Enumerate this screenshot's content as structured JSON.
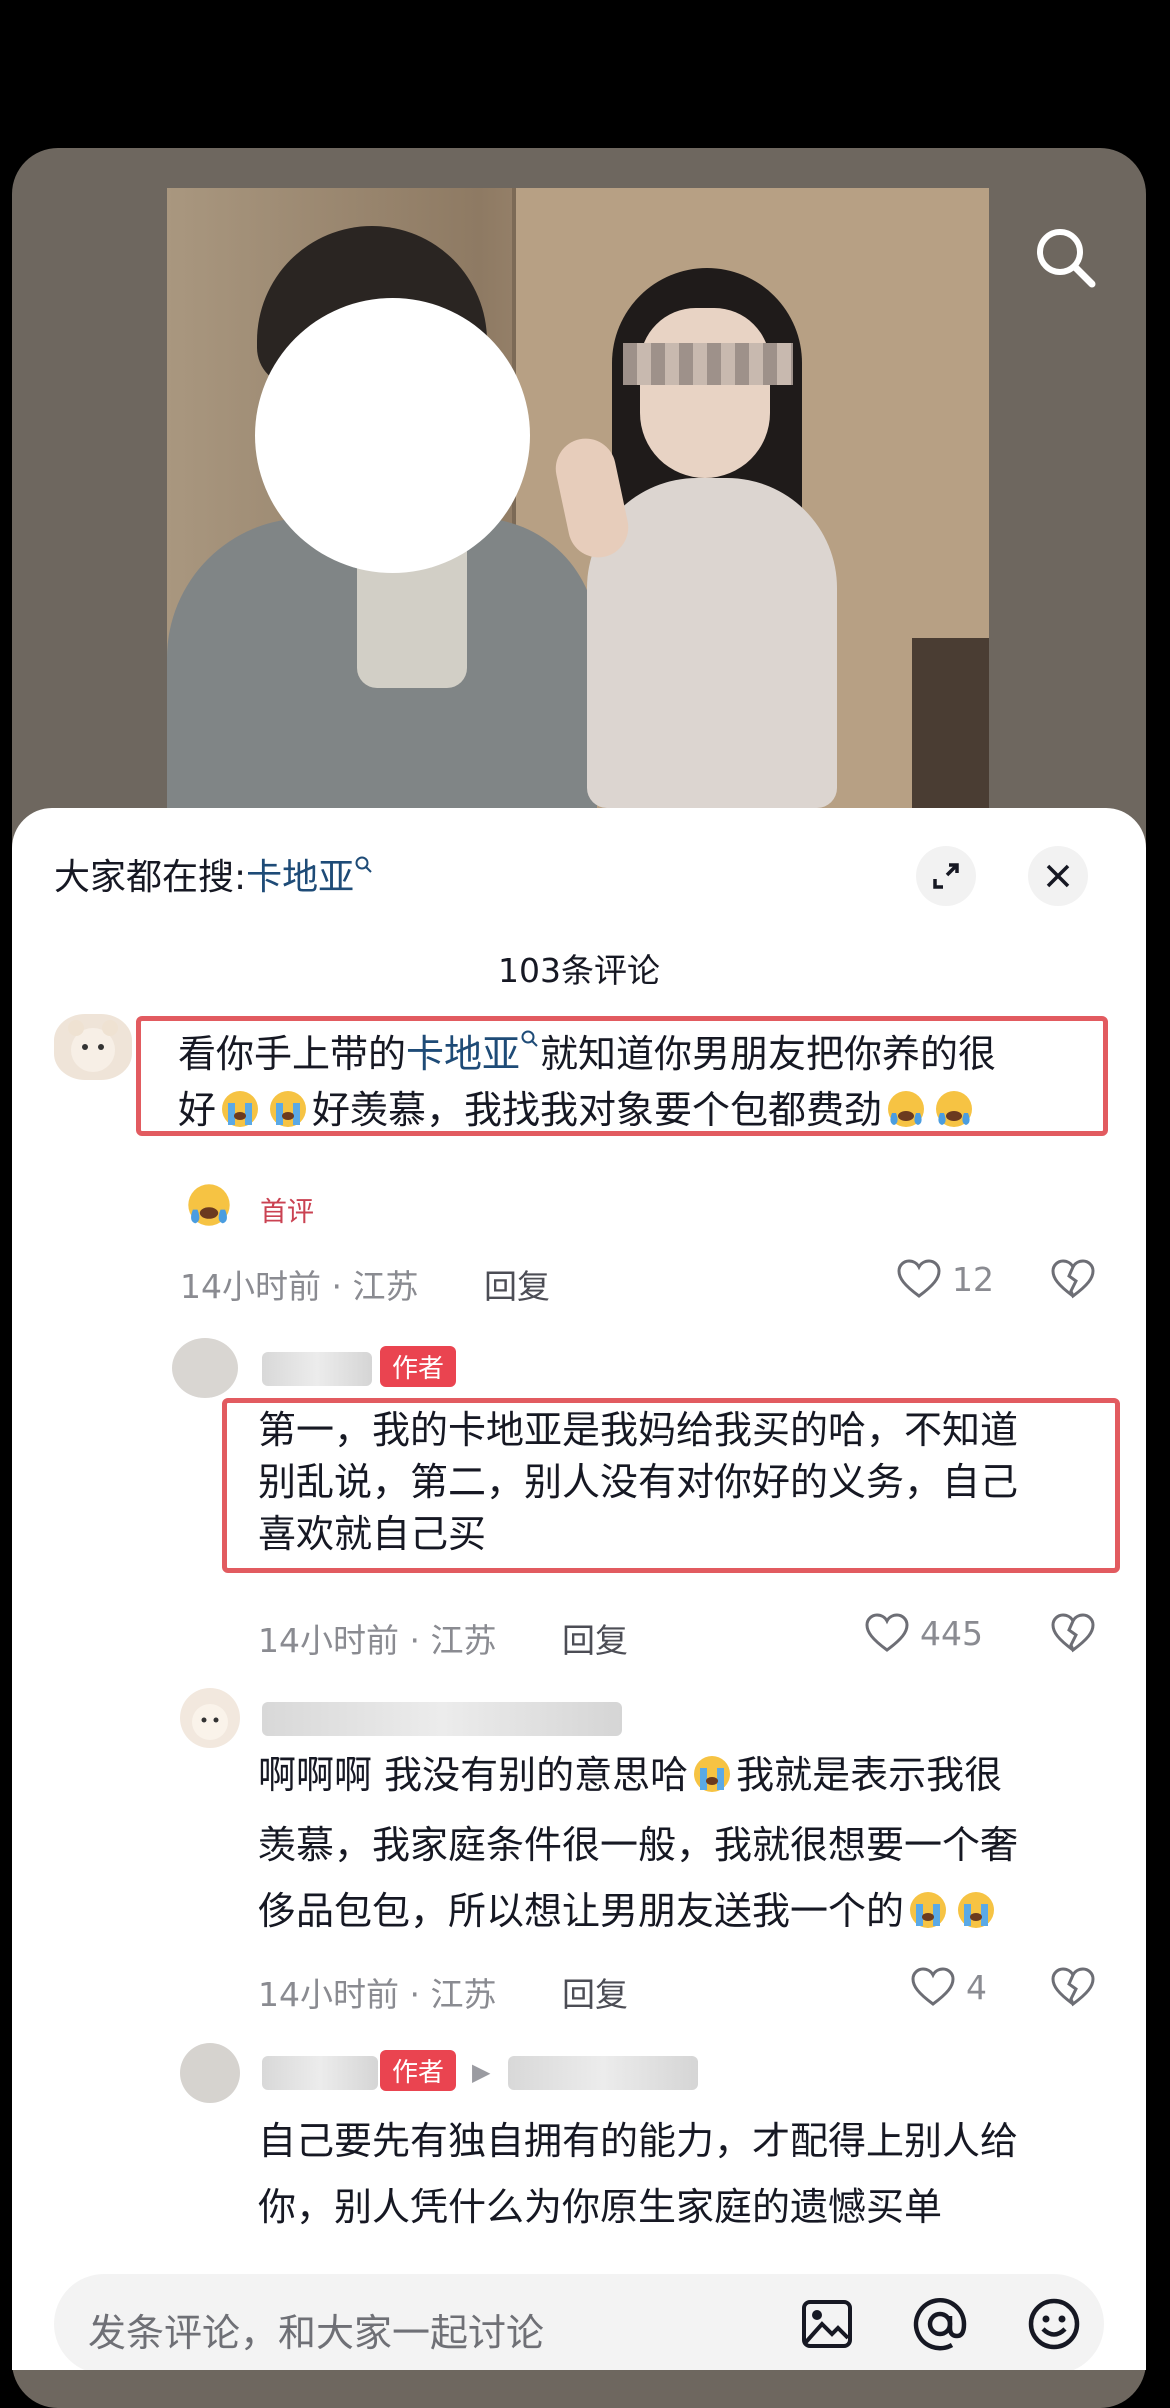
{
  "hot_search": {
    "prefix": "大家都在搜:",
    "keyword": "卡地亚"
  },
  "comments_count": "103条评论",
  "comments": [
    {
      "text_before": "看你手上带的",
      "link": "卡地亚",
      "text_line1_after": "就知道你男朋友把你养的很",
      "line2_a": "好",
      "line2_b": "好羡慕，我找我对象要个包都费劲",
      "badge": "首评",
      "meta": "14小时前 · 江苏",
      "reply": "回复",
      "likes": "12"
    },
    {
      "tag": "作者",
      "lines": [
        "第一，我的卡地亚是我妈给我买的哈，不知道",
        "别乱说，第二，别人没有对你好的义务，自己",
        "喜欢就自己买"
      ],
      "meta": "14小时前 · 江苏",
      "reply": "回复",
      "likes": "445"
    },
    {
      "line1_a": "啊啊啊 我没有别的意思哈",
      "line1_b": "我就是表示我很",
      "line2": "羡慕，我家庭条件很一般，我就很想要一个奢",
      "line3": "侈品包包，所以想让男朋友送我一个的",
      "meta": "14小时前 · 江苏",
      "reply": "回复",
      "likes": "4"
    },
    {
      "tag": "作者",
      "lines": [
        "自己要先有独自拥有的能力，才配得上别人给",
        "你，别人凭什么为你原生家庭的遗憾买单"
      ]
    }
  ],
  "input": {
    "placeholder": "发条评论，和大家一起讨论"
  },
  "icons": [
    "search-icon",
    "expand-icon",
    "close-icon",
    "heart-icon",
    "broken-heart-icon",
    "image-icon",
    "at-icon",
    "emoji-icon",
    "crying-emoji",
    "tearful-emoji"
  ],
  "colors": {
    "link": "#1e4b77",
    "author_tag": "#ea4450",
    "highlight_box": "#e25b60"
  }
}
